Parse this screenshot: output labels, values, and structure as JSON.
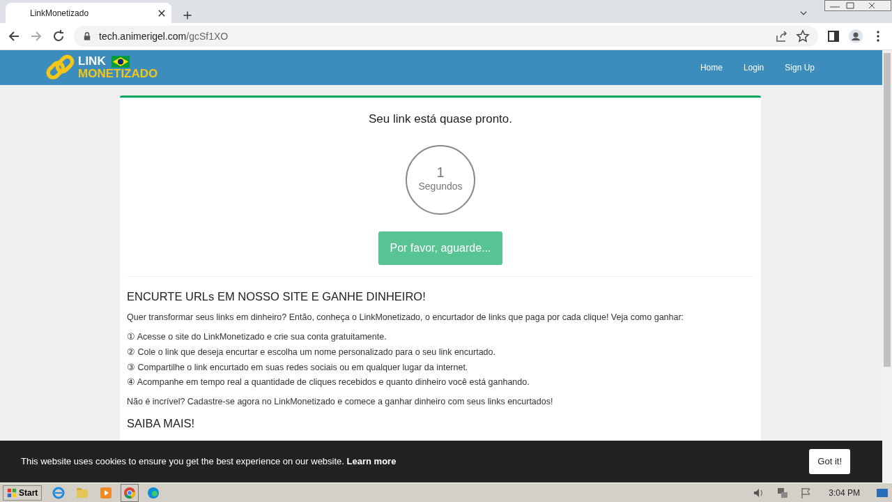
{
  "browser": {
    "tab": {
      "title": "LinkMonetizado"
    },
    "address": {
      "host": "tech.animerigel.com",
      "path": "/gcSf1XO"
    }
  },
  "navbar": {
    "logo": {
      "line1": "LINK",
      "line2": "MONETIZADO"
    },
    "links": [
      "Home",
      "Login",
      "Sign Up"
    ]
  },
  "card": {
    "title": "Seu link está quase pronto.",
    "countdown": {
      "value": "1",
      "unit": "Segundos"
    },
    "button": {
      "label": "Por favor, aguarde...",
      "disabled": true
    },
    "heading": "ENCURTE URLs EM NOSSO SITE E GANHE DINHEIRO!",
    "intro": "Quer transformar seus links em dinheiro? Então, conheça o LinkMonetizado, o encurtador de links que paga por cada clique! Veja como ganhar:",
    "steps": [
      "① Acesse o site do LinkMonetizado e crie sua conta gratuitamente.",
      "② Cole o link que deseja encurtar e escolha um nome personalizado para o seu link encurtado.",
      "③ Compartilhe o link encurtado em suas redes sociais ou em qualquer lugar da internet.",
      "④ Acompanhe em tempo real a quantidade de cliques recebidos e quanto dinheiro você está ganhando."
    ],
    "closing": "Não é incrível? Cadastre-se agora no LinkMonetizado e comece a ganhar dinheiro com seus links encurtados!",
    "more_heading": "SAIBA MAIS!"
  },
  "cookie_bar": {
    "text": "This website uses cookies to ensure you get the best experience on our website.",
    "link": "Learn more",
    "button": "Got it!"
  },
  "taskbar": {
    "start": "Start",
    "clock": "3:04 PM"
  }
}
